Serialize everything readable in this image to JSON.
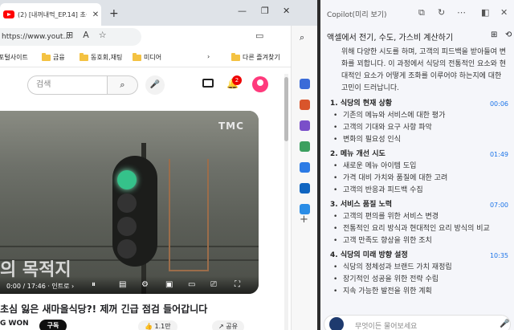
{
  "browser": {
    "tab": {
      "title": "(2) [내꺼내먹_EP.14] 초심 잃"
    },
    "new_tab": "+",
    "window_controls": {
      "minimize": "—",
      "restore": "❐",
      "close": "✕"
    },
    "address": {
      "url": "https://www.yout..."
    },
    "bookmarks": [
      "포털사이트",
      "금융",
      "동호회,재팅",
      "미디어",
      "다른 즐겨찾기"
    ],
    "bookmarks_more": "›"
  },
  "youtube": {
    "search_placeholder": "검색",
    "notification_count": "2",
    "video": {
      "overlay_text": "의 목적지",
      "brand_mark": "TMC",
      "time": "0:00 / 17:46 · 인트로 ›",
      "title": "초심 잃은 새마을식당?! 제꺼 긴급 점검 들어갑니다",
      "channel": "G WON",
      "subscribe": "구독",
      "likes": "1.1만",
      "share": "공유"
    }
  },
  "copilot": {
    "header_title": "Copilot(미리 보기)",
    "subtitle": "액셀에서 전기, 수도, 가스비 계산하기",
    "intro": "위해 다양한 시도를 하며, 고객의 피드백을 받아들여 변화를 꾀합니다. 이 과정에서 식당의 전통적인 요소와 현대적인 요소가 어떻게 조화를 이루어야 하는지에 대한 고민이 드러납니다.",
    "sections": [
      {
        "heading": "1. 식당의 현재 상황",
        "time": "00:06",
        "bullets": [
          "기존의 메뉴와 서비스에 대한 평가",
          "고객의 기대와 요구 사항 파악",
          "변화의 필요성 인식"
        ]
      },
      {
        "heading": "2. 메뉴 개선 시도",
        "time": "01:49",
        "bullets": [
          "새로운 메뉴 아이템 도입",
          "가격 대비 가치와 품질에 대한 고려",
          "고객의 반응과 피드백 수집"
        ]
      },
      {
        "heading": "3. 서비스 품질 노력",
        "time": "07:00",
        "bullets": [
          "고객의 편의를 위한 서비스 변경",
          "전통적인 요리 방식과 현대적인 요리 방식의 비교",
          "고객 만족도 향상을 위한 조치"
        ]
      },
      {
        "heading": "4. 식당의 미래 방향 설정",
        "time": "10:35",
        "bullets": [
          "식당의 정체성과 브랜드 가치 재정립",
          "장기적인 성공을 위한 전략 수립",
          "지속 가능한 발전을 위한 계획"
        ]
      }
    ],
    "input_placeholder": "무엇이든 물어보세요"
  }
}
